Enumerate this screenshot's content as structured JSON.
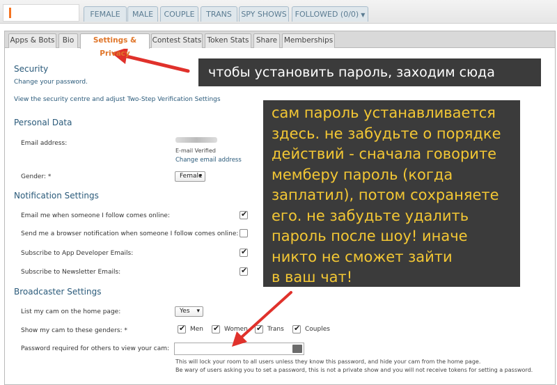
{
  "top_tabs": [
    {
      "label": "FEMALE"
    },
    {
      "label": "MALE"
    },
    {
      "label": "COUPLE"
    },
    {
      "label": "TRANS"
    },
    {
      "label": "SPY SHOWS"
    },
    {
      "label": "FOLLOWED (0/0)"
    }
  ],
  "panel_tabs": [
    {
      "label": "Apps & Bots"
    },
    {
      "label": "Bio"
    },
    {
      "label": "Settings & Privacy",
      "active": true
    },
    {
      "label": "Contest Stats"
    },
    {
      "label": "Token Stats"
    },
    {
      "label": "Share"
    },
    {
      "label": "Memberships"
    }
  ],
  "security": {
    "heading": "Security",
    "change_password": "Change your password.",
    "security_centre": "View the security centre and adjust Two-Step Verification Settings"
  },
  "personal": {
    "heading": "Personal Data",
    "email_label": "Email address:",
    "email_verified": "E-mail Verified",
    "change_email": "Change email address",
    "gender_label": "Gender: *",
    "gender_value": "Female"
  },
  "notifications": {
    "heading": "Notification Settings",
    "items": [
      {
        "label": "Email me when someone I follow comes online:",
        "checked": true
      },
      {
        "label": "Send me a browser notification when someone I follow comes online:",
        "checked": false
      },
      {
        "label": "Subscribe to App Developer Emails:",
        "checked": true
      },
      {
        "label": "Subscribe to Newsletter Emails:",
        "checked": true
      }
    ]
  },
  "broadcaster": {
    "heading": "Broadcaster Settings",
    "list_cam_label": "List my cam on the home page:",
    "list_cam_value": "Yes",
    "show_genders_label": "Show my cam to these genders: *",
    "genders": [
      {
        "label": "Men",
        "checked": true
      },
      {
        "label": "Women",
        "checked": true
      },
      {
        "label": "Trans",
        "checked": true
      },
      {
        "label": "Couples",
        "checked": true
      }
    ],
    "password_label": "Password required for others to view your cam:",
    "password_value": "",
    "note1": "This will lock your room to all users unless they know this password, and hide your cam from the home page.",
    "note2": "Be wary of users asking you to set a password, this is not a private show and you will not receive tokens for setting a password."
  },
  "annotations": {
    "top": "чтобы установить пароль, заходим сюда",
    "box_lines": [
      "сам пароль устанавливается",
      "здесь. не забудьте о порядке",
      "действий - сначала говорите",
      "мемберу пароль (когда",
      "заплатил), потом сохраняете",
      "его. не забудьте удалить",
      "пароль после шоу! иначе",
      "никто не сможет зайти",
      "в ваш чат!"
    ]
  },
  "colors": {
    "accent": "#e0762a",
    "heading": "#2a5a7a",
    "overlay_bg": "#3b3b3b",
    "overlay_text": "#f3c734",
    "arrow": "#e0312b"
  }
}
